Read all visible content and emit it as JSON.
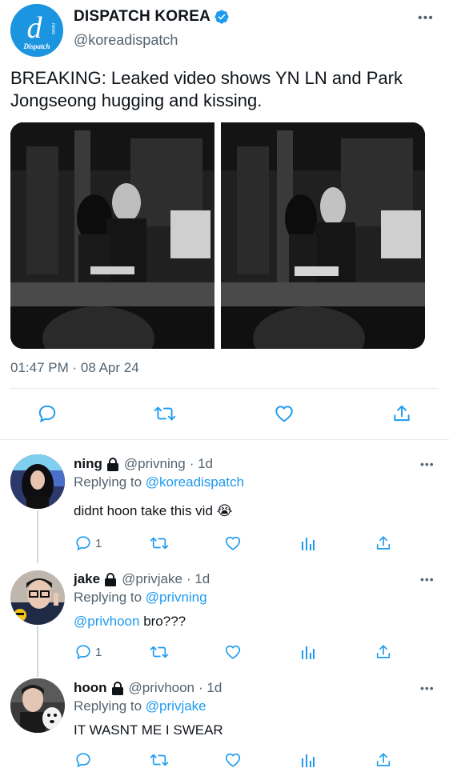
{
  "tweet": {
    "display_name": "DISPATCH KOREA",
    "handle": "@koreadispatch",
    "avatar_letter": "d",
    "avatar_word": "Dispatch",
    "avatar_side_text": "news",
    "text": "BREAKING: Leaked video shows YN LN and Park Jongseong hugging and kissing.",
    "timestamp": "01:47 PM · 08 Apr 24",
    "more": "•••"
  },
  "replies": [
    {
      "name": "ning",
      "handle": "@privning",
      "time": "· 1d",
      "replying_label": "Replying to",
      "replying_to": "@koreadispatch",
      "text_mention": "",
      "text": "didnt hoon take this vid",
      "emoji": "😭",
      "reply_count": "1",
      "more": "•••"
    },
    {
      "name": "jake",
      "handle": "@privjake",
      "time": "· 1d",
      "replying_label": "Replying to",
      "replying_to": "@privning",
      "text_mention": "@privhoon",
      "text": " bro???",
      "emoji": "",
      "reply_count": "1",
      "more": "•••"
    },
    {
      "name": "hoon",
      "handle": "@privhoon",
      "time": "· 1d",
      "replying_label": "Replying to",
      "replying_to": "@privjake",
      "text_mention": "",
      "text": "IT WASNT ME I SWEAR",
      "emoji": "",
      "reply_count": "",
      "more": "•••"
    }
  ],
  "colors": {
    "accent": "#1d9bf0",
    "secondary_text": "#536471",
    "avatar_brand": "#1b95e0"
  },
  "icons": [
    "reply-icon",
    "retweet-icon",
    "like-icon",
    "share-icon",
    "analytics-icon",
    "verified-badge-icon",
    "lock-icon",
    "more-icon"
  ]
}
